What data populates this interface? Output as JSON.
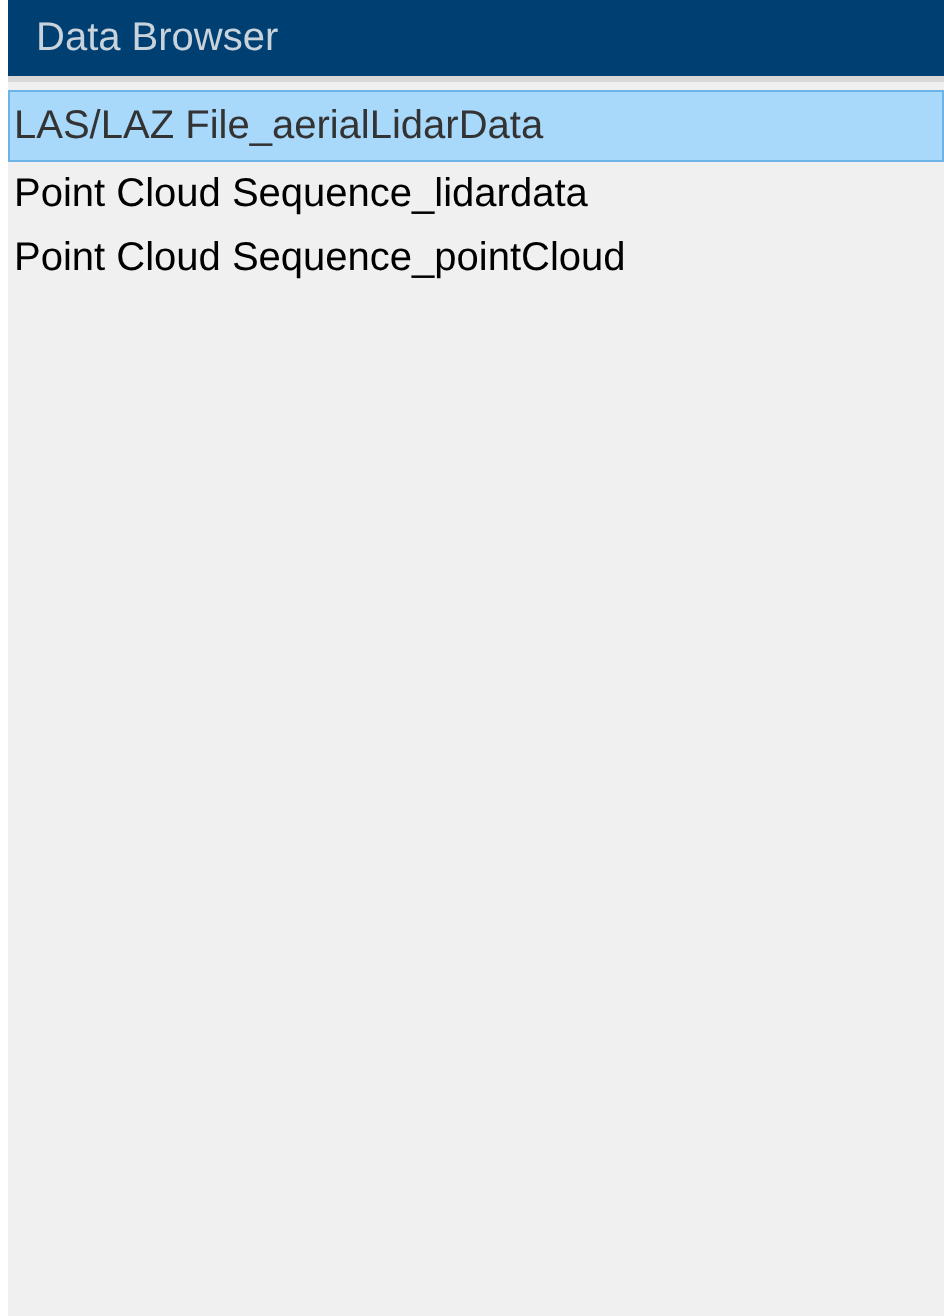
{
  "panel": {
    "title": "Data Browser"
  },
  "items": [
    {
      "label": "LAS/LAZ File_aerialLidarData",
      "selected": true
    },
    {
      "label": "Point Cloud Sequence_lidardata",
      "selected": false
    },
    {
      "label": "Point Cloud Sequence_pointCloud",
      "selected": false
    }
  ]
}
